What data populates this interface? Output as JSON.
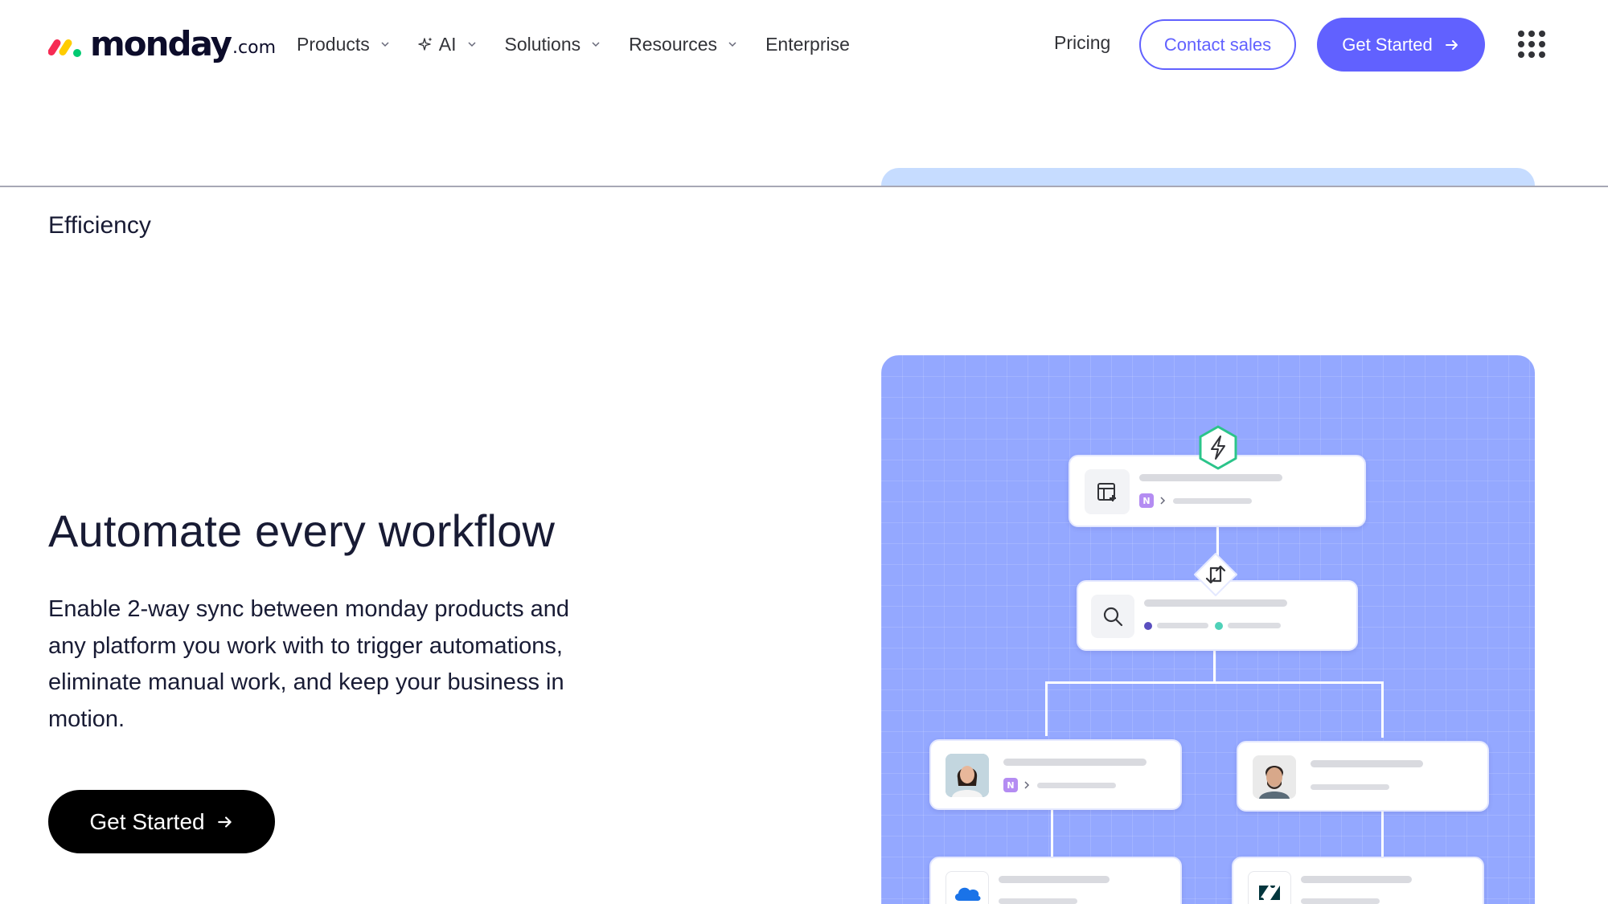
{
  "nav": {
    "logo_word": "monday",
    "logo_suffix": ".com",
    "items": [
      {
        "label": "Products",
        "has_dropdown": true
      },
      {
        "label": "AI",
        "has_dropdown": true,
        "icon": "sparkle-icon"
      },
      {
        "label": "Solutions",
        "has_dropdown": true
      },
      {
        "label": "Resources",
        "has_dropdown": true
      },
      {
        "label": "Enterprise",
        "has_dropdown": false
      }
    ],
    "pricing": "Pricing",
    "contact_sales": "Contact sales",
    "get_started": "Get Started",
    "apps_menu_icon": "grid-menu-icon"
  },
  "section": {
    "eyebrow": "Efficiency",
    "headline": "Automate every workflow",
    "description": "Enable 2-way sync between monday products and any platform you work with to trigger automations, eliminate manual work, and keep your business in motion.",
    "cta": "Get Started"
  },
  "illustration": {
    "trigger_icon": "lightning-icon",
    "sync_icon": "sync-arrows-icon",
    "nodes": [
      {
        "icon": "board-add-icon",
        "badge": "N"
      },
      {
        "icon": "search-icon"
      },
      {
        "icon": "avatar-woman",
        "badge": "N"
      },
      {
        "icon": "avatar-man"
      },
      {
        "icon": "onedrive-cloud-icon"
      },
      {
        "icon": "zendesk-icon"
      }
    ]
  },
  "colors": {
    "brand": "#6161ff",
    "illustration_bg": "#94a8ff",
    "trigger_green": "#2bc48a",
    "text": "#181b34"
  }
}
